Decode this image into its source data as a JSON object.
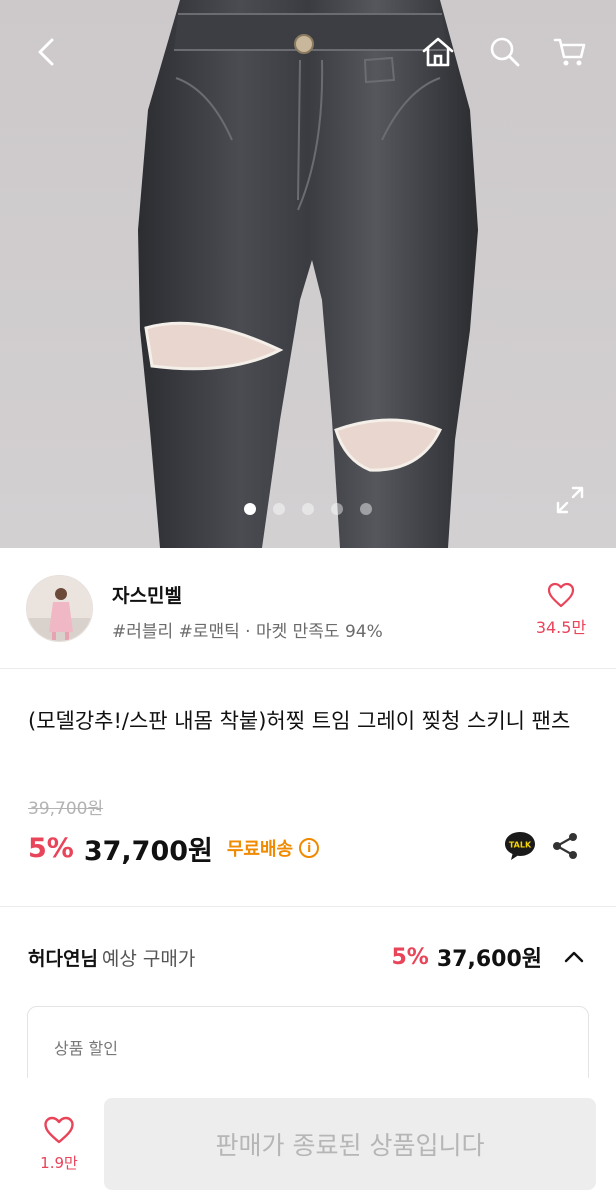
{
  "header": {
    "icons": [
      "back-icon",
      "home-icon",
      "search-icon",
      "cart-icon"
    ]
  },
  "gallery": {
    "total_images": 5,
    "active_index": 0,
    "expand_icon": "expand-icon"
  },
  "shop": {
    "name": "자스민벨",
    "tags": "#러블리 #로맨틱 · 마켓 만족도 94%",
    "like_count": "34.5만"
  },
  "product": {
    "title": "(모델강추!/스판 내몸 착붙)허찢 트임 그레이 찢청 스키니 팬츠",
    "original_price": "39,700원",
    "discount": "5%",
    "price": "37,700원",
    "shipping": "무료배송",
    "info_icon": "i",
    "kakao_label": "TALK"
  },
  "member_price": {
    "name": "허다연님",
    "label": "예상 구매가",
    "discount": "5%",
    "price": "37,600원",
    "card_label": "상품 할인"
  },
  "bottom_bar": {
    "like_count": "1.9만",
    "status_button": "판매가 종료된 상품입니다"
  },
  "colors": {
    "accent_red": "#e8445a",
    "shipping_orange": "#f08a00",
    "kakao_yellow": "#1a1a1a"
  }
}
